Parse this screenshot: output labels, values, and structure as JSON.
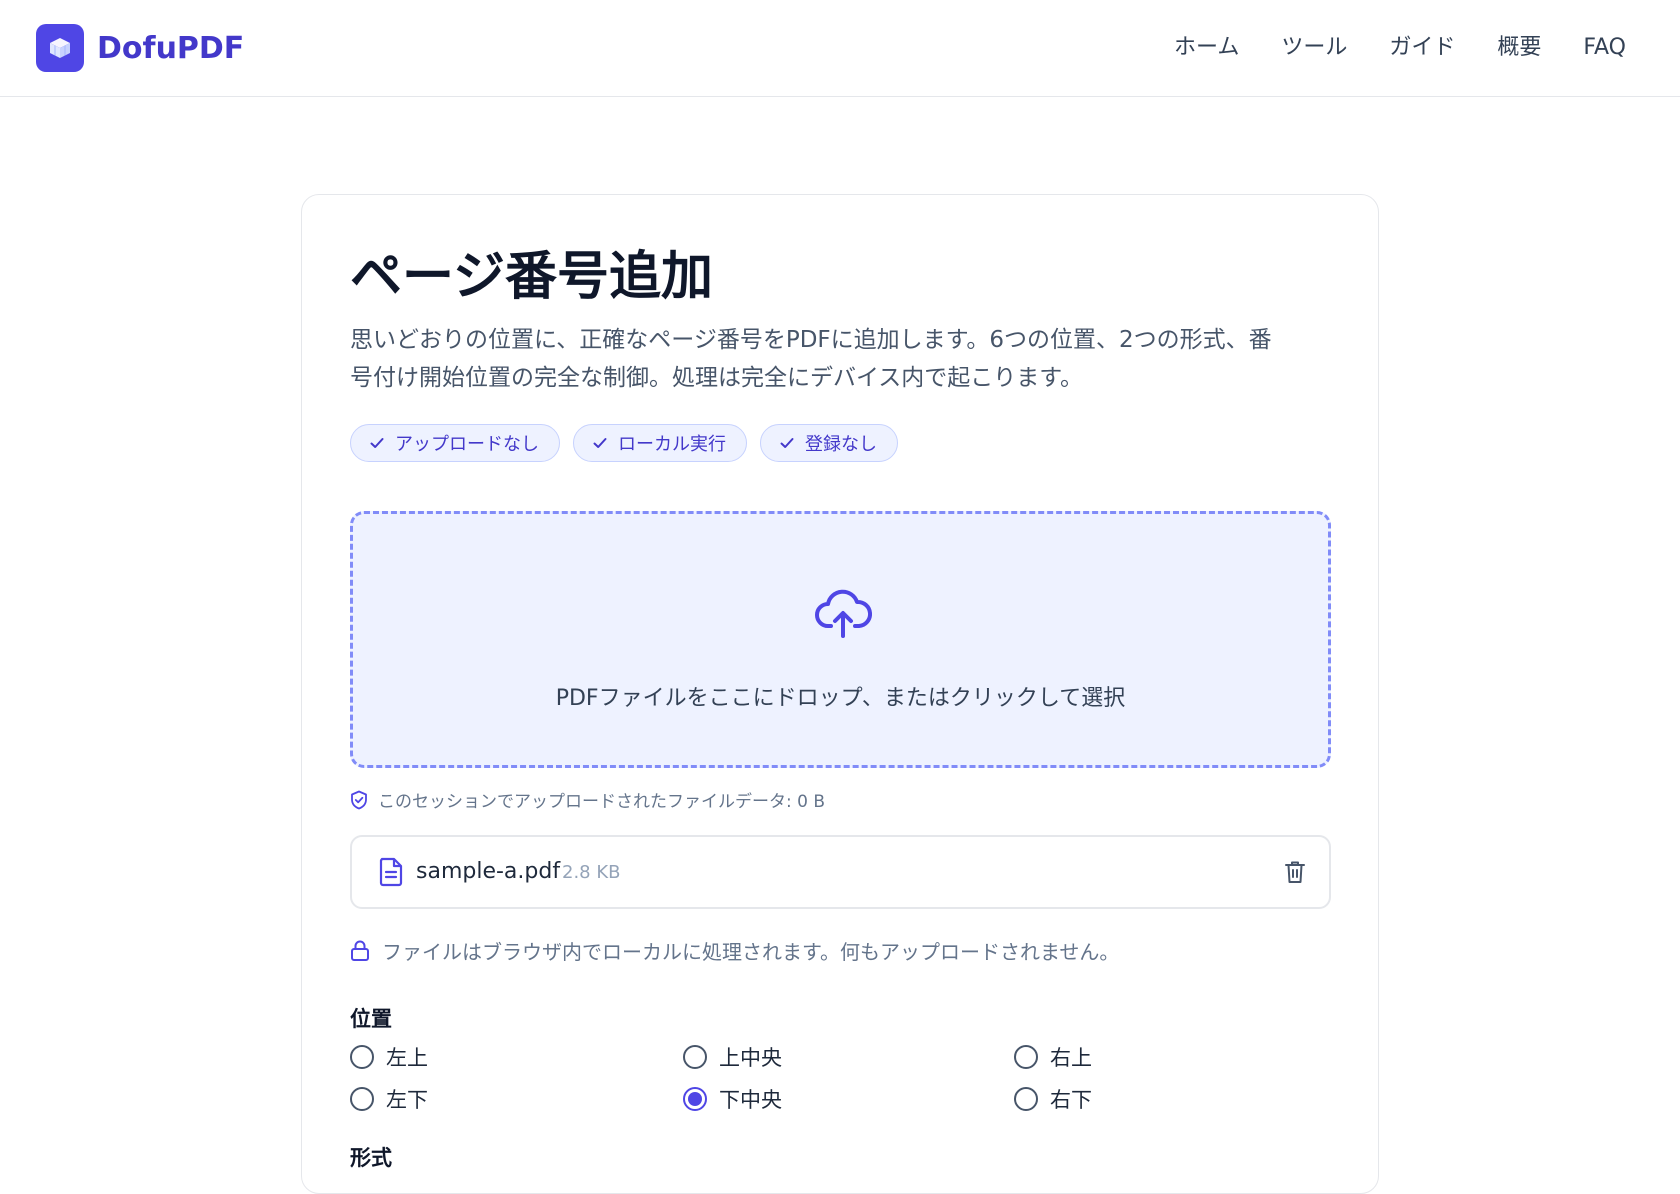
{
  "header": {
    "brand": "DofuPDF",
    "nav": [
      "ホーム",
      "ツール",
      "ガイド",
      "概要",
      "FAQ"
    ]
  },
  "tool": {
    "title": "ページ番号追加",
    "description_line1": "思いどおりの位置に、正確なページ番号をPDFに追加します。6つの位置、2つの形式、番",
    "description_line2": "号付け開始位置の完全な制御。処理は完全にデバイス内で起こります。",
    "badges": [
      "アップロードなし",
      "ローカル実行",
      "登録なし"
    ]
  },
  "dropzone": {
    "text": "PDFファイルをここにドロップ、またはクリックして選択",
    "session_note": "このセッションでアップロードされたファイルデータ: 0 B"
  },
  "file": {
    "name": "sample-a.pdf",
    "size": "2.8 KB"
  },
  "privacy_note": "ファイルはブラウザ内でローカルに処理されます。何もアップロードされません。",
  "position": {
    "label": "位置",
    "options": [
      "左上",
      "上中央",
      "右上",
      "左下",
      "下中央",
      "右下"
    ],
    "selected": "下中央"
  },
  "format": {
    "label": "形式"
  },
  "colors": {
    "accent": "#4f46e5",
    "brand_text": "#4338ca",
    "badge_bg": "#eef2ff",
    "dropzone_border": "#818cf8"
  }
}
